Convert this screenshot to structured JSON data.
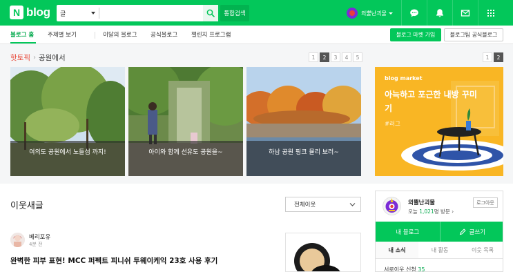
{
  "header": {
    "logo_letter": "N",
    "logo_text": "blog",
    "search_scope": "글",
    "search_value": "",
    "integrated_search": "통합검색",
    "user_name": "외뿔난괴물",
    "icons": [
      "chat-icon",
      "bell-icon",
      "mail-icon",
      "grid-menu-icon"
    ],
    "brand_color": "#03c75a"
  },
  "subnav": {
    "items": [
      "블로그 홈",
      "주제별 보기",
      "이달의 블로그",
      "공식블로그",
      "챌린지 프로그램"
    ],
    "active": "블로그 홈",
    "market_button": "블로그 마켓 가입",
    "official_button": "블로그팀 공식블로그"
  },
  "hot_topic": {
    "label": "핫토픽",
    "subtitle": "공원에서",
    "pages": [
      "1",
      "2",
      "3",
      "4",
      "5"
    ],
    "active_page": "2",
    "cards": [
      {
        "caption": "여의도 공원에서 노들섬 까지!"
      },
      {
        "caption": "아이와 함께 선유도 공원을~"
      },
      {
        "caption": "하남 공원 핑크 뮬리 보러~"
      }
    ]
  },
  "ad": {
    "pages": [
      "1",
      "2"
    ],
    "active_page": "2",
    "brand": "blog market",
    "headline": "아늑하고 포근한 내방 꾸미기",
    "tag": "#러그"
  },
  "feed": {
    "title": "이웃새글",
    "filter": "전체이웃",
    "post": {
      "author": "베리포유",
      "time": "4분 전",
      "title": "완벽한 피부 표현! MCC 퍼펙트 피니쉬 투웨이케익 23호 사용 후기"
    }
  },
  "profile": {
    "name": "외뿔난괴물",
    "visit_prefix": "오늘",
    "visit_count": "1,021",
    "visit_suffix": "명 방문",
    "logout": "로그아웃",
    "my_blog": "내 블로그",
    "write": "글쓰기",
    "tabs": [
      "내 소식",
      "내 활동",
      "이웃 목록"
    ],
    "active_tab": "내 소식",
    "stat_label": "서로이웃 신청",
    "stat_value": "35"
  }
}
